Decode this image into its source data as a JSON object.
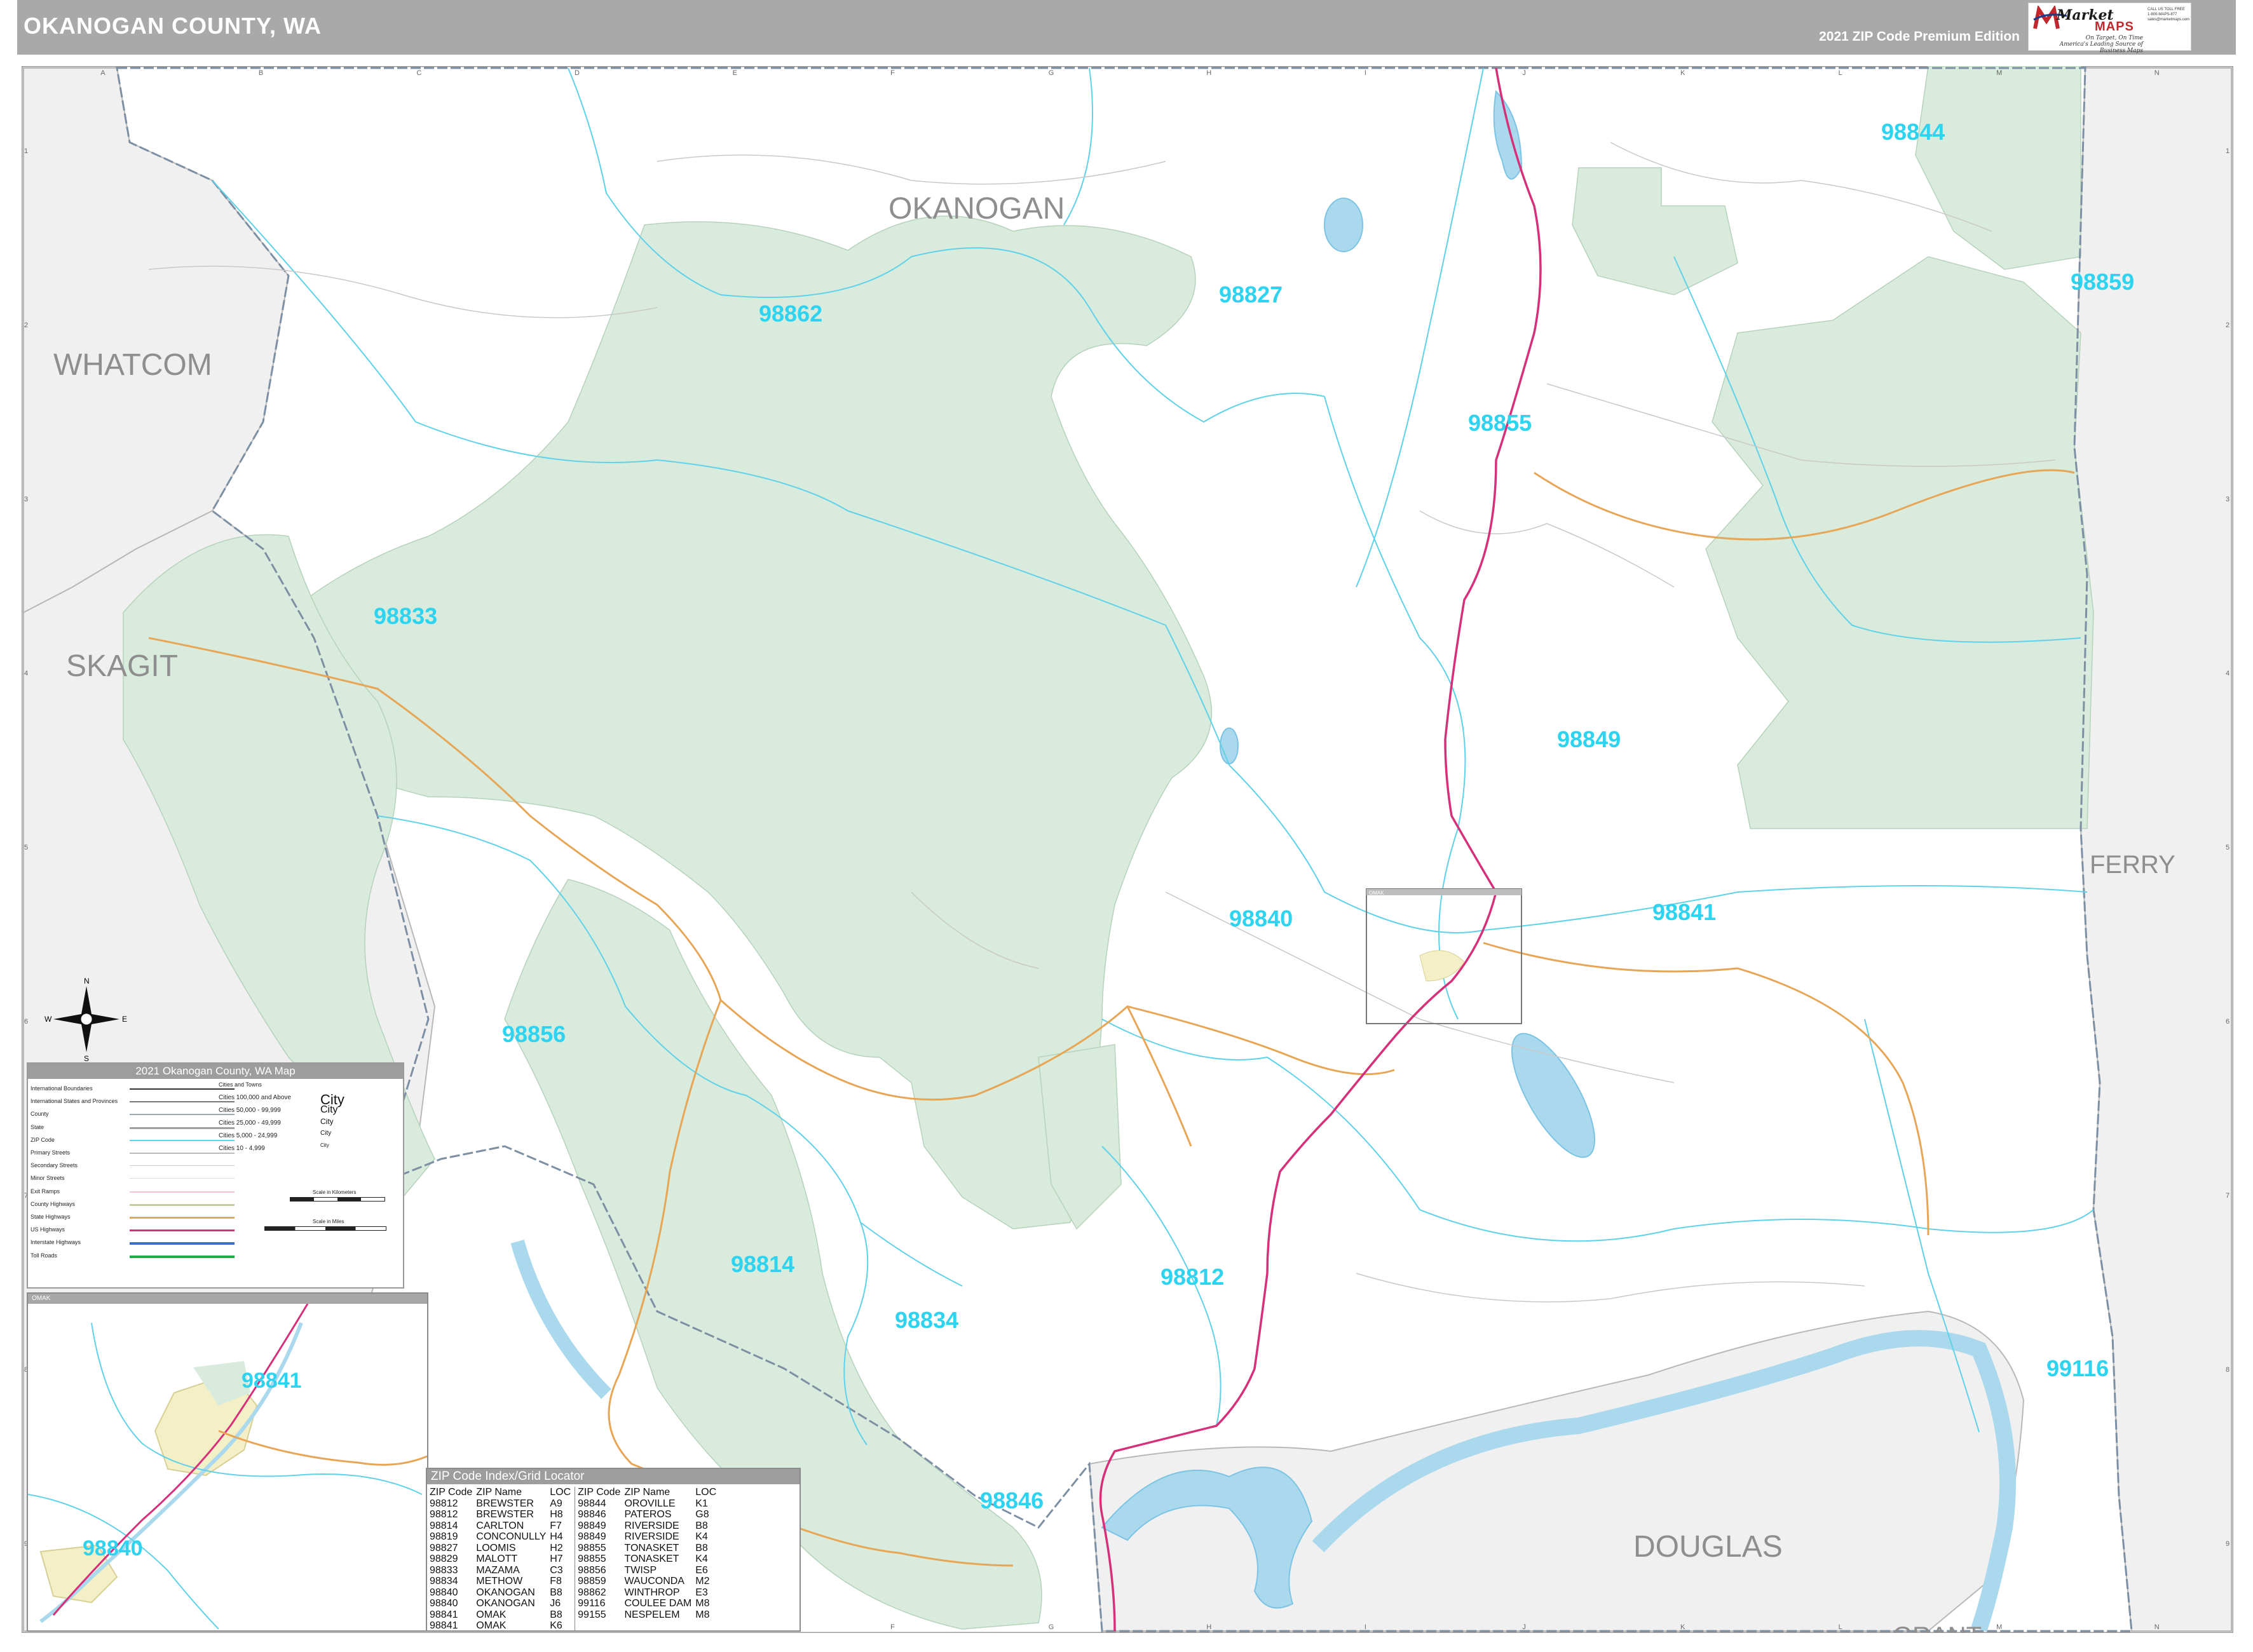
{
  "header": {
    "title": "OKANOGAN COUNTY, WA",
    "edition": "2021 ZIP Code Premium Edition",
    "logo": {
      "brand_top": "Market",
      "brand_bottom": "MAPS",
      "tagline_1": "On Target, On Time",
      "tagline_2": "America's Leading Source of Business Maps",
      "phone_line_1": "CALL US TOLL FREE",
      "phone_line_2": "1-800-MAPS-877",
      "phone_line_3": "sales@marketmaps.com"
    }
  },
  "colors": {
    "header_bg": "#a9a9a9",
    "forest": "#d9ebdc",
    "outside_county": "#f0f0f0",
    "water": "#aad9ee",
    "zip_label": "#2ed3f0",
    "zip_boundary": "#5fd1e8",
    "us_highway": "#d6307a",
    "state_highway": "#e7a556",
    "county_line": "#7c8fa3"
  },
  "map": {
    "grid_columns": [
      "A",
      "B",
      "C",
      "D",
      "E",
      "F",
      "G",
      "H",
      "I",
      "J",
      "K",
      "L",
      "M",
      "N"
    ],
    "grid_rows": [
      "1",
      "2",
      "3",
      "4",
      "5",
      "6",
      "7",
      "8",
      "9"
    ],
    "regions": {
      "okanogan": "OKANOGAN",
      "whatcom": "WHATCOM",
      "skagit": "SKAGIT",
      "ferry": "FERRY",
      "douglas": "DOUGLAS",
      "grant": "GRANT"
    },
    "zip_labels": {
      "z98844": "98844",
      "z98859": "98859",
      "z98827": "98827",
      "z98862": "98862",
      "z98855": "98855",
      "z98833": "98833",
      "z98849": "98849",
      "z98840": "98840",
      "z98841": "98841",
      "z98856": "98856",
      "z98814": "98814",
      "z98812": "98812",
      "z98834": "98834",
      "z99116": "99116",
      "z98846": "98846"
    },
    "compass": {
      "n": "N",
      "s": "S",
      "e": "E",
      "w": "W"
    },
    "inset_label": "OMAK"
  },
  "legend": {
    "title": "2021 Okanogan County, WA Map",
    "rows": [
      "International Boundaries",
      "International States and Provinces",
      "County",
      "State",
      "ZIP Code",
      "Primary Streets",
      "Secondary Streets",
      "Minor Streets",
      "Exit Ramps",
      "County Highways",
      "State Highways",
      "US Highways",
      "Interstate Highways",
      "Toll Roads"
    ],
    "cities_header": "Cities and Towns",
    "city_rows": [
      {
        "label": "Cities 100,000 and Above",
        "sample": "City"
      },
      {
        "label": "Cities 50,000 - 99,999",
        "sample": "City"
      },
      {
        "label": "Cities 25,000 - 49,999",
        "sample": "City"
      },
      {
        "label": "Cities 5,000 - 24,999",
        "sample": "City"
      },
      {
        "label": "Cities 10 - 4,999",
        "sample": "City"
      }
    ],
    "scale_km": "Scale in Kilometers",
    "scale_mi": "Scale in Miles"
  },
  "inset": {
    "title": "OMAK",
    "zip_98841": "98841",
    "zip_98840": "98840"
  },
  "zip_index": {
    "title": "ZIP Code Index/Grid Locator",
    "headers": [
      "ZIP Code",
      "ZIP Name",
      "LOC",
      "ZIP Code",
      "ZIP Name",
      "LOC"
    ],
    "rows": [
      [
        "98812",
        "BREWSTER",
        "A9",
        "98844",
        "OROVILLE",
        "K1"
      ],
      [
        "98812",
        "BREWSTER",
        "H8",
        "98846",
        "PATEROS",
        "G8"
      ],
      [
        "98814",
        "CARLTON",
        "F7",
        "98849",
        "RIVERSIDE",
        "B8"
      ],
      [
        "98819",
        "CONCONULLY",
        "H4",
        "98849",
        "RIVERSIDE",
        "K4"
      ],
      [
        "98827",
        "LOOMIS",
        "H2",
        "98855",
        "TONASKET",
        "B8"
      ],
      [
        "98829",
        "MALOTT",
        "H7",
        "98855",
        "TONASKET",
        "K4"
      ],
      [
        "98833",
        "MAZAMA",
        "C3",
        "98856",
        "TWISP",
        "E6"
      ],
      [
        "98834",
        "METHOW",
        "F8",
        "98859",
        "WAUCONDA",
        "M2"
      ],
      [
        "98840",
        "OKANOGAN",
        "B8",
        "98862",
        "WINTHROP",
        "E3"
      ],
      [
        "98840",
        "OKANOGAN",
        "J6",
        "99116",
        "COULEE DAM",
        "M8"
      ],
      [
        "98841",
        "OMAK",
        "B8",
        "99155",
        "NESPELEM",
        "M8"
      ],
      [
        "98841",
        "OMAK",
        "K6",
        "",
        "",
        ""
      ]
    ]
  }
}
